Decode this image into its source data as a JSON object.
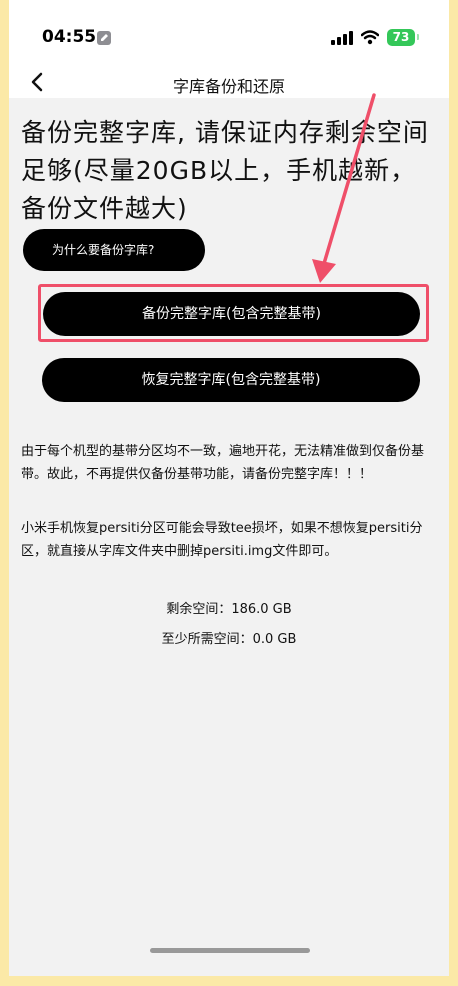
{
  "status_bar": {
    "time": "04:55",
    "battery": "73"
  },
  "nav": {
    "title": "字库备份和还原"
  },
  "headline": "备份完整字库, 请保证内存剩余空间足够(尽量20GB以上，手机越新，备份文件越大)",
  "buttons": {
    "why": "为什么要备份字库?",
    "backup": "备份完整字库(包含完整基带)",
    "restore": "恢复完整字库(包含完整基带)"
  },
  "notes": {
    "baseband": "由于每个机型的基带分区均不一致，遍地开花，无法精准做到仅备份基带。故此，不再提供仅备份基带功能，请备份完整字库！！！",
    "persist": "小米手机恢复persiti分区可能会导致tee损坏，如果不想恢复persiti分区，就直接从字库文件夹中删掉persiti.img文件即可。"
  },
  "storage": {
    "remaining": "剩余空间：186.0 GB",
    "required": "至少所需空间：0.0 GB"
  },
  "colors": {
    "annotation": "#ef4f69",
    "battery": "#34c759",
    "surface": "#f2f2f2"
  },
  "icons": {
    "back": "chevron-left",
    "status": [
      "developer-wrench",
      "cellular-signal",
      "wifi"
    ]
  }
}
